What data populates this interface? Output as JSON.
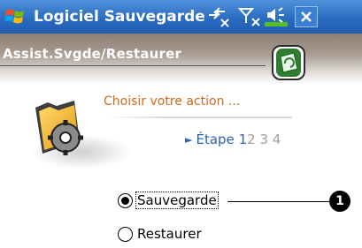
{
  "titlebar": {
    "app_title": "Logiciel Sauvegarde",
    "icons": [
      "windows-start-icon",
      "connectivity-icon",
      "signal-off-icon",
      "volume-icon",
      "close-icon"
    ],
    "close_label": "✕"
  },
  "header": {
    "title": "Assist.Svgde/Restaurer",
    "icon": "backup-app-icon"
  },
  "step": {
    "action_text": "Choisir votre action ...",
    "step_word": "Étape",
    "current": "1",
    "others": [
      "2",
      "3",
      "4"
    ],
    "icon": "folder-gear-icon"
  },
  "options": [
    {
      "label": "Sauvegarde",
      "selected": true
    },
    {
      "label": "Restaurer",
      "selected": false
    }
  ],
  "callout": {
    "number": "1"
  },
  "colors": {
    "titlebar": "#2a6bc0",
    "accent_text": "#d2691e",
    "step_link": "#2b5fb8"
  }
}
